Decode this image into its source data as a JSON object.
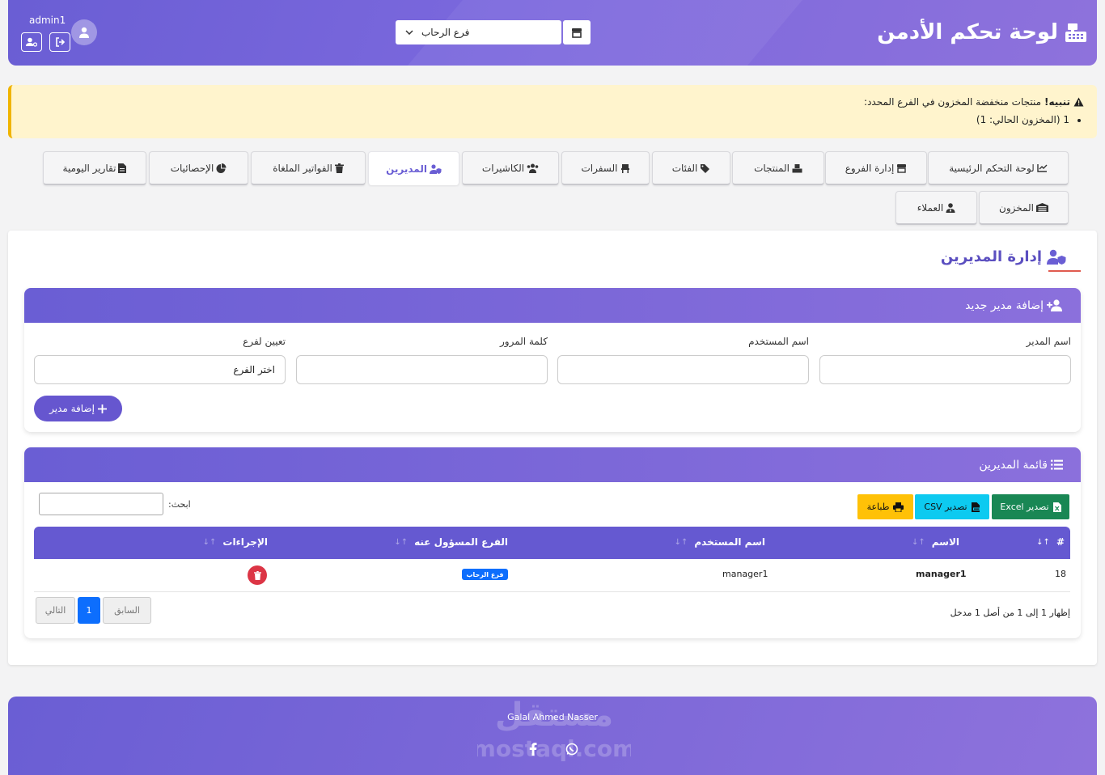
{
  "header": {
    "title": "لوحة تحكم الأدمن",
    "branch_selected": "فرع الرحاب",
    "user": "admin1"
  },
  "alert": {
    "title": "تنبيه!",
    "message": " منتجات منخفضة المخزون في الفرع المحدد:",
    "item": "1 (المخزون الحالي: 1)"
  },
  "tabs": [
    {
      "label": "لوحة التحكم الرئيسية",
      "icon": "chart-line-icon"
    },
    {
      "label": "إدارة الفروع",
      "icon": "store-icon"
    },
    {
      "label": "المنتجات",
      "icon": "boxes-icon"
    },
    {
      "label": "الفئات",
      "icon": "tags-icon"
    },
    {
      "label": "السفرات",
      "icon": "chair-icon"
    },
    {
      "label": "الكاشيرات",
      "icon": "users-icon"
    },
    {
      "label": "المديرين",
      "icon": "user-shield-icon",
      "active": true
    },
    {
      "label": "الفواتير الملغاة",
      "icon": "trash-icon"
    },
    {
      "label": "الإحصائيات",
      "icon": "pie-chart-icon"
    },
    {
      "label": "تقارير اليومية",
      "icon": "file-icon"
    },
    {
      "label": "المخزون",
      "icon": "warehouse-icon"
    },
    {
      "label": "العملاء",
      "icon": "user-tie-icon"
    }
  ],
  "page": {
    "title": "إدارة المديرين"
  },
  "add_form": {
    "header": "إضافة مدير جديد",
    "fields": {
      "name_label": "اسم المدير",
      "username_label": "اسم المستخدم",
      "password_label": "كلمة المرور",
      "branch_label": "تعيين لفرع",
      "branch_value": "اختر الفرع"
    },
    "submit": "إضافة مدير"
  },
  "list": {
    "header": "قائمة المديرين",
    "export_excel": "تصدير Excel",
    "export_csv": "تصدير CSV",
    "print": "طباعة",
    "search_label": "ابحث:",
    "columns": [
      "#",
      "الاسم",
      "اسم المستخدم",
      "الفرع المسؤول عنه",
      "الإجراءات"
    ],
    "rows": [
      {
        "id": "18",
        "name": "manager1",
        "username": "manager1",
        "branch": "فرع الرحاب"
      }
    ],
    "info": "إظهار 1 إلى 1 من أصل 1 مدخل",
    "prev": "السابق",
    "page": "1",
    "next": "التالي"
  },
  "footer": {
    "author": "Galal Ahmed Nasser",
    "watermark": "مستقل mostaql.com"
  },
  "colors": {
    "primary": "#6a5ed4",
    "primary_end": "#8e72dc",
    "danger": "#dc3545",
    "warning": "#ffc107",
    "info": "#0dcaf0",
    "success": "#198754",
    "badge": "#0d6efd"
  }
}
